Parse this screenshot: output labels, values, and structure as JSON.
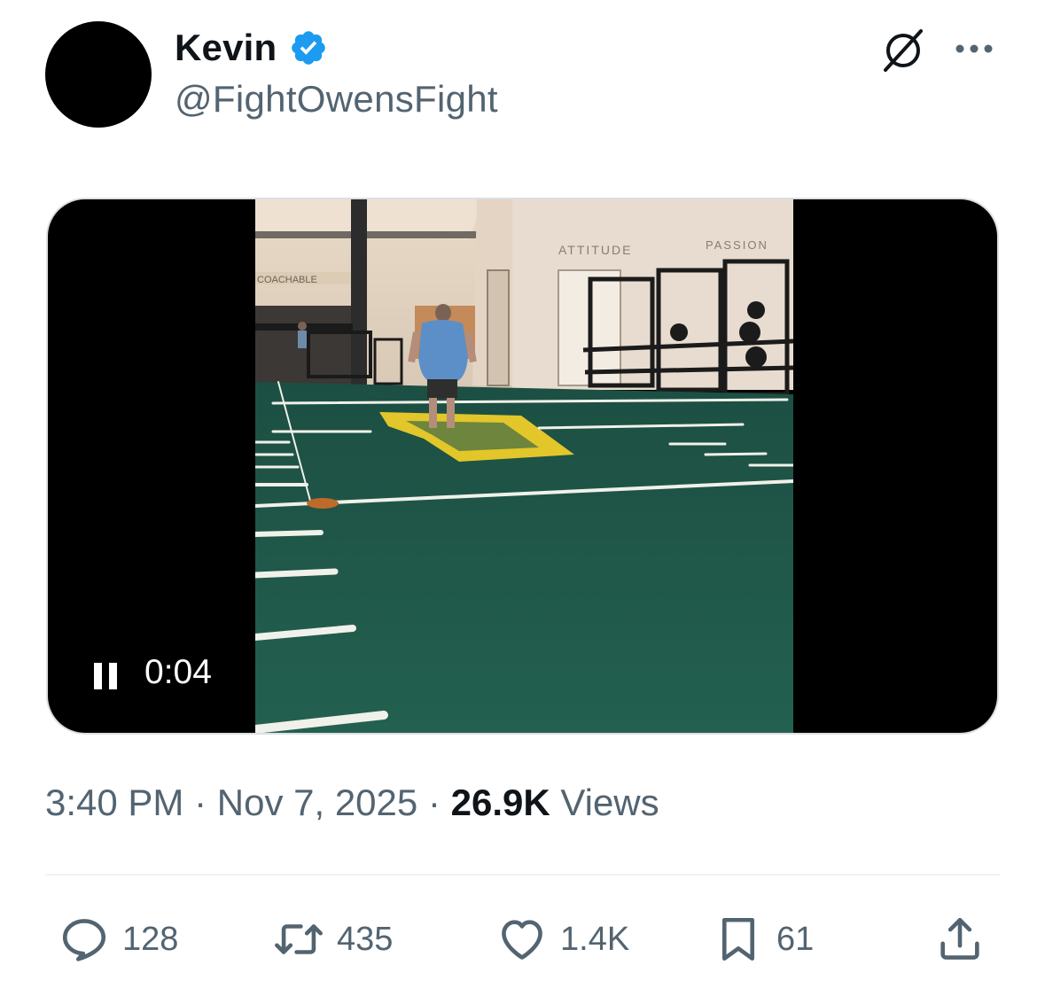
{
  "tweet": {
    "author_name": "Kevin",
    "author_handle": "@FightOwensFight",
    "verified_color": "#1d9bf0"
  },
  "media": {
    "type": "video",
    "playback_state": "playing",
    "control_icon": "pause-icon",
    "elapsed_time": "0:04",
    "signs": [
      "COACHABLE",
      "ATTITUDE",
      "PASSION"
    ]
  },
  "meta": {
    "time": "3:40 PM",
    "separator": "·",
    "date": "Nov 7, 2025",
    "views_count": "26.9K",
    "views_label": "Views"
  },
  "actions": {
    "reply": {
      "icon": "reply-icon",
      "count": "128"
    },
    "retweet": {
      "icon": "retweet-icon",
      "count": "435"
    },
    "like": {
      "icon": "heart-icon",
      "count": "1.4K"
    },
    "bookmark": {
      "icon": "bookmark-icon",
      "count": "61"
    },
    "share": {
      "icon": "share-icon"
    }
  },
  "colors": {
    "secondary_text": "#536471",
    "primary_text": "#0f1419",
    "turf": "#1f5a4a"
  }
}
